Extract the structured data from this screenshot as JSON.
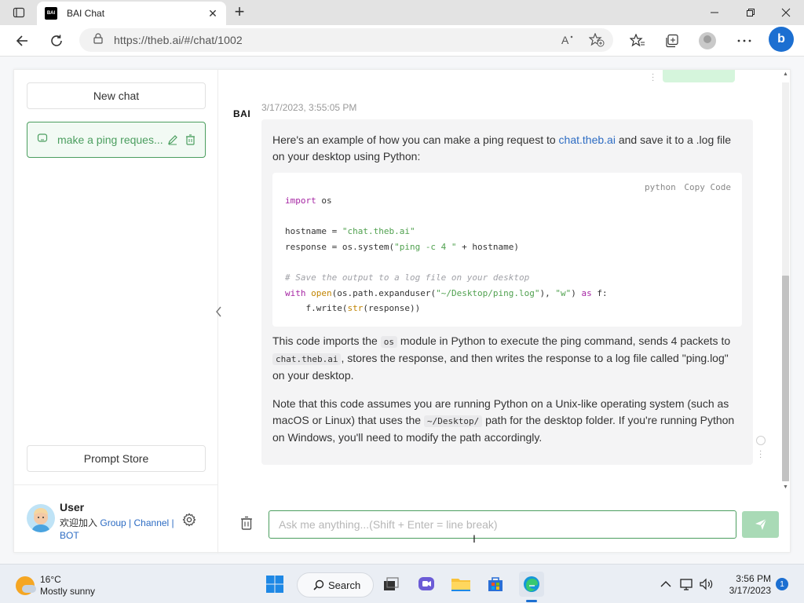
{
  "browser": {
    "tab_title": "BAI Chat",
    "favicon_text": "BAI",
    "url": "https://theb.ai/#/chat/1002",
    "bing_label": "b"
  },
  "sidebar": {
    "new_chat_label": "New chat",
    "chat_items": [
      {
        "label": "make a ping reques..."
      }
    ],
    "prompt_store_label": "Prompt Store",
    "user": {
      "name": "User",
      "join_text": "欢迎加入",
      "link_group": "Group",
      "separator": " | ",
      "link_channel": "Channel",
      "link_bot": "BOT"
    }
  },
  "messages": {
    "timestamp": "3/17/2023, 3:55:05 PM",
    "bot_logo_text": "BAI",
    "intro": {
      "before_link": "Here's an example of how you can make a ping request to ",
      "link": "chat.theb.ai",
      "after_link": " and save it to a .log file on your desktop using Python:"
    },
    "code": {
      "language": "python",
      "copy_label": "Copy Code",
      "lines": [
        "import os",
        "",
        "hostname = \"chat.theb.ai\"",
        "response = os.system(\"ping -c 4 \" + hostname)",
        "",
        "# Save the output to a log file on your desktop",
        "with open(os.path.expanduser(\"~/Desktop/ping.log\"), \"w\") as f:",
        "    f.write(str(response))"
      ]
    },
    "paragraph2": {
      "part1": "This code imports the ",
      "code1": "os",
      "part2": " module in Python to execute the ping command, sends 4 packets to ",
      "code2": "chat.theb.ai",
      "part3": ", stores the response, and then writes the response to a log file called \"ping.log\" on your desktop."
    },
    "paragraph3": {
      "part1": "Note that this code assumes you are running Python on a Unix-like operating system (such as macOS or Linux) that uses the ",
      "code1": "~/Desktop/",
      "part2": " path for the desktop folder. If you're running Python on Windows, you'll need to modify the path accordingly."
    }
  },
  "input": {
    "placeholder": "Ask me anything...(Shift + Enter = line break)"
  },
  "taskbar": {
    "temperature": "16°C",
    "condition": "Mostly sunny",
    "search_label": "Search",
    "time": "3:56 PM",
    "date": "3/17/2023",
    "notification_count": "1"
  },
  "colors": {
    "accent_green": "#4b9e5f",
    "link_blue": "#2d6cc3",
    "send_button": "#a9dab6"
  },
  "icons": {
    "tab_actions": "tab-actions-icon",
    "back": "arrow-left-icon",
    "refresh": "refresh-icon",
    "lock": "lock-icon",
    "read_aloud": "read-aloud-icon",
    "add_favorite": "star-plus-icon",
    "favorites": "favorites-icon",
    "collections": "collections-icon",
    "more": "more-horizontal-icon",
    "chat": "chat-bubble-icon",
    "edit": "pencil-icon",
    "delete": "trash-icon",
    "settings": "gear-icon",
    "send": "paper-plane-icon"
  }
}
